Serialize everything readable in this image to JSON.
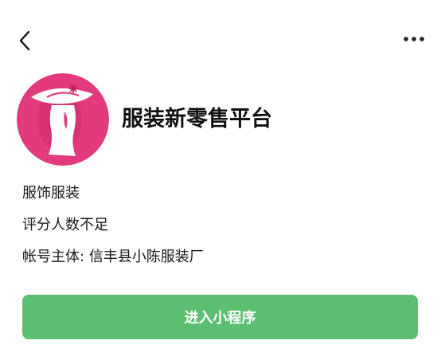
{
  "nav": {
    "back_icon": "chevron-left-icon",
    "more_icon": "more-horizontal-icon"
  },
  "profile": {
    "app_name": "服装新零售平台",
    "avatar_icon": "woman-with-hat-logo",
    "avatar_color": "#e23a7c"
  },
  "info": {
    "category": "服饰服装",
    "rating": "评分人数不足",
    "account_label": "帐号主体:",
    "account_value": "信丰县小陈服装厂"
  },
  "action": {
    "enter_label": "进入小程序",
    "button_color": "#5cbe71"
  }
}
